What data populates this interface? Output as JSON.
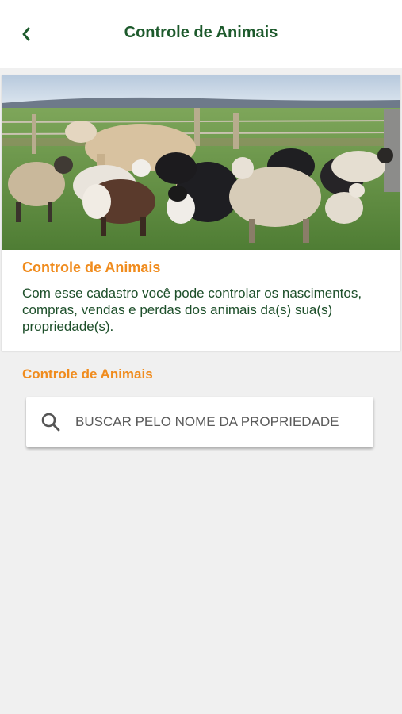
{
  "header": {
    "title": "Controle de Animais",
    "back_icon": "chevron-left-icon"
  },
  "card": {
    "image_alt": "Rebanho de ovelhas e uma vaca no pasto",
    "title": "Controle de  Animais",
    "description": "Com esse cadastro você pode controlar os nascimentos, compras, vendas e perdas dos animais da(s) sua(s) propriedade(s)."
  },
  "section": {
    "label": "Controle de  Animais"
  },
  "search": {
    "icon": "search-icon",
    "placeholder": "BUSCAR PELO NOME DA PROPRIEDADE",
    "value": ""
  },
  "colors": {
    "primary_green": "#1d5a2c",
    "accent_orange": "#f08c1e",
    "background": "#f0f0f0"
  }
}
